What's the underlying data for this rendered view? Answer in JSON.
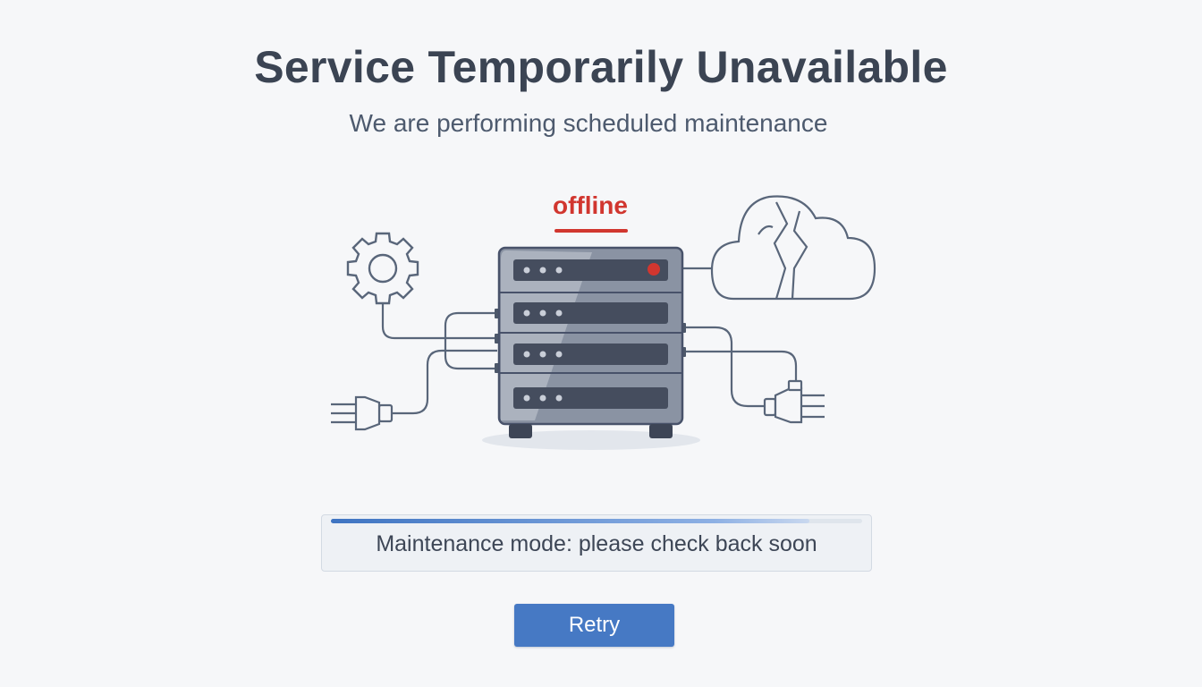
{
  "page": {
    "title": "Service Temporarily Unavailable",
    "subtitle": "We are performing scheduled maintenance"
  },
  "illustration": {
    "status_label": "offline",
    "status_color": "#d1362f",
    "icons": [
      "gear-icon",
      "server-rack-icon",
      "broken-cloud-icon",
      "power-plug-icon",
      "power-socket-icon"
    ]
  },
  "progress": {
    "message": "Maintenance mode: please check back soon",
    "fill_fraction": 0.9,
    "accent_color": "#4679c4"
  },
  "actions": {
    "retry_label": "Retry"
  }
}
